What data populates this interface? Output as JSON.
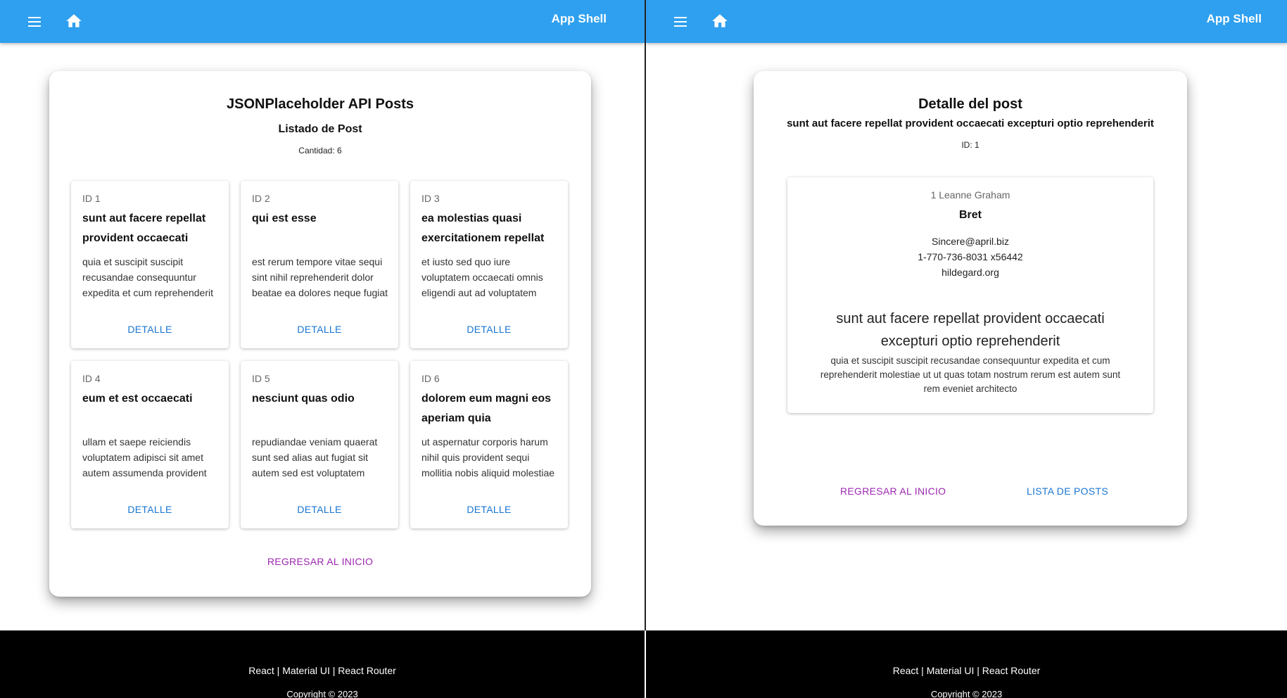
{
  "appbar": {
    "title": "App Shell"
  },
  "footer": {
    "links": "React | Material UI | React Router",
    "copyright": "Copyright © 2023"
  },
  "list_page": {
    "title": "JSONPlaceholder API Posts",
    "subtitle": "Listado de Post",
    "count": "Cantidad: 6",
    "detail_label": "DETALLE",
    "back_label": "REGRESAR AL INICIO",
    "posts": [
      {
        "id": "ID 1",
        "title": "sunt aut facere repellat provident occaecati",
        "body": "quia et suscipit suscipit recusandae consequuntur expedita et cum reprehenderit molestiae"
      },
      {
        "id": "ID 2",
        "title": "qui est esse",
        "body": "est rerum tempore vitae sequi sint nihil reprehenderit dolor beatae ea dolores neque fugiat blanditiis"
      },
      {
        "id": "ID 3",
        "title": "ea molestias quasi exercitationem repellat",
        "body": "et iusto sed quo iure voluptatem occaecati omnis eligendi aut ad voluptatem doloribus vel accusantium"
      },
      {
        "id": "ID 4",
        "title": "eum et est occaecati",
        "body": "ullam et saepe reiciendis voluptatem adipisci sit amet autem assumenda provident rerum culpa quis hic"
      },
      {
        "id": "ID 5",
        "title": "nesciunt quas odio",
        "body": "repudiandae veniam quaerat sunt sed alias aut fugiat sit autem sed est voluptatem omnis possimus"
      },
      {
        "id": "ID 6",
        "title": "dolorem eum magni eos aperiam quia",
        "body": "ut aspernatur corporis harum nihil quis provident sequi mollitia nobis aliquid molestiae perspiciatis"
      }
    ]
  },
  "detail_page": {
    "title": "Detalle del post",
    "post_title": "sunt aut facere repellat provident occaecati excepturi optio reprehenderit",
    "post_id": "ID: 1",
    "user": {
      "name": "1 Leanne Graham",
      "username": "Bret",
      "email": "Sincere@april.biz",
      "phone": "1-770-736-8031 x56442",
      "website": "hildegard.org"
    },
    "post_heading": "sunt aut facere repellat provident occaecati excepturi optio reprehenderit",
    "post_body": "quia et suscipit suscipit recusandae consequuntur expedita et cum reprehenderit molestiae ut ut quas totam nostrum rerum est autem sunt rem eveniet architecto",
    "back_label": "REGRESAR AL INICIO",
    "list_label": "LISTA DE POSTS"
  },
  "icons": {
    "menu": "menu-icon",
    "home": "home-icon"
  }
}
